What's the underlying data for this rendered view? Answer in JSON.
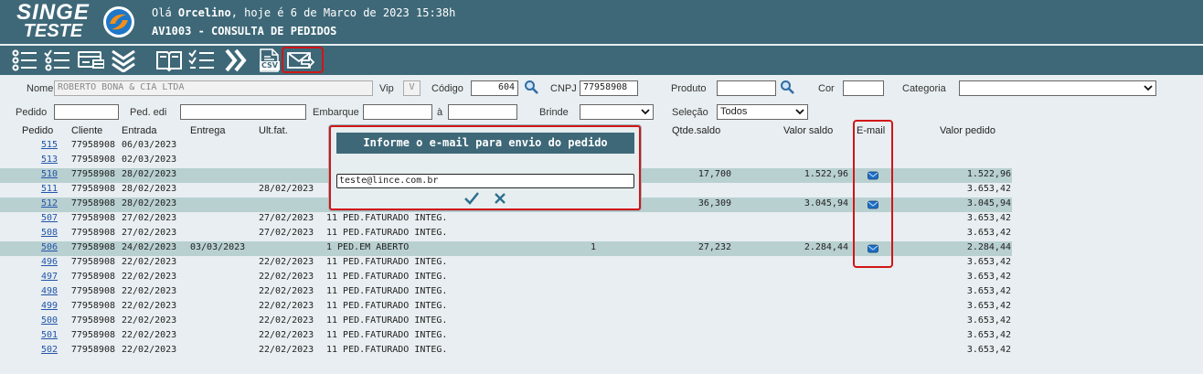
{
  "header": {
    "logo_line1": "SINGE",
    "logo_line2": "TESTE",
    "greeting_prefix": "Olá ",
    "user": "Orcelino",
    "greeting_suffix": ", hoje é 6 de Marco de 2023 15:38h",
    "screen_title": "AV1003 - CONSULTA DE PEDIDOS"
  },
  "toolbar": {
    "icons": [
      "list-icon",
      "checklist-icon",
      "card-icon",
      "chevrons-down-icon",
      "book-icon",
      "checklist-alt-icon",
      "chevrons-right-icon",
      "csv-icon",
      "send-email-icon"
    ],
    "csv_label": "CSV"
  },
  "filters": {
    "nome_label": "Nome",
    "nome_value": "ROBERTO BONA & CIA LTDA",
    "vip_label": "Vip",
    "vip_value": "V",
    "codigo_label": "Código",
    "codigo_value": "604",
    "cnpj_label": "CNPJ",
    "cnpj_value": "77958908",
    "produto_label": "Produto",
    "produto_value": "",
    "cor_label": "Cor",
    "cor_value": "",
    "categoria_label": "Categoria",
    "categoria_value": "",
    "pedido_label": "Pedido",
    "pedido_value": "",
    "ped_edi_label": "Ped. edi",
    "ped_edi_value": "",
    "embarque_label": "Embarque",
    "embarque_from": "",
    "ate_label": "à",
    "embarque_to": "",
    "brinde_label": "Brinde",
    "brinde_value": "",
    "selecao_label": "Seleção",
    "selecao_value": "Todos"
  },
  "table": {
    "headers": {
      "pedido": "Pedido",
      "cliente": "Cliente",
      "entrada": "Entrada",
      "entrega": "Entrega",
      "ult_fat": "Ult.fat.",
      "qtde_saldo": "Qtde.saldo",
      "valor_saldo": "Valor saldo",
      "email": "E-mail",
      "valor_pedido": "Valor pedido"
    },
    "rows": [
      {
        "pedido": "515",
        "cliente": "77958908",
        "entrada": "06/03/2023",
        "entrega": "",
        "ult_fat": "",
        "status": "",
        "qtd": "",
        "qtde_saldo": "",
        "valor_saldo": "",
        "email": false,
        "valor_pedido": "",
        "highlight": false
      },
      {
        "pedido": "513",
        "cliente": "77958908",
        "entrada": "02/03/2023",
        "entrega": "",
        "ult_fat": "",
        "status": "",
        "qtd": "",
        "qtde_saldo": "",
        "valor_saldo": "",
        "email": false,
        "valor_pedido": "",
        "highlight": false
      },
      {
        "pedido": "510",
        "cliente": "77958908",
        "entrada": "28/02/2023",
        "entrega": "",
        "ult_fat": "",
        "status": "",
        "qtd": "",
        "qtde_saldo": "17,700",
        "valor_saldo": "1.522,96",
        "email": true,
        "valor_pedido": "1.522,96",
        "highlight": true
      },
      {
        "pedido": "511",
        "cliente": "77958908",
        "entrada": "28/02/2023",
        "entrega": "",
        "ult_fat": "28/02/2023",
        "status": "",
        "qtd": "",
        "qtde_saldo": "",
        "valor_saldo": "",
        "email": false,
        "valor_pedido": "3.653,42",
        "highlight": false
      },
      {
        "pedido": "512",
        "cliente": "77958908",
        "entrada": "28/02/2023",
        "entrega": "",
        "ult_fat": "",
        "status": "",
        "qtd": "",
        "qtde_saldo": "36,309",
        "valor_saldo": "3.045,94",
        "email": true,
        "valor_pedido": "3.045,94",
        "highlight": true
      },
      {
        "pedido": "507",
        "cliente": "77958908",
        "entrada": "27/02/2023",
        "entrega": "",
        "ult_fat": "27/02/2023",
        "status": "11 PED.FATURADO INTEG.",
        "qtd": "",
        "qtde_saldo": "",
        "valor_saldo": "",
        "email": false,
        "valor_pedido": "3.653,42",
        "highlight": false
      },
      {
        "pedido": "508",
        "cliente": "77958908",
        "entrada": "27/02/2023",
        "entrega": "",
        "ult_fat": "27/02/2023",
        "status": "11 PED.FATURADO INTEG.",
        "qtd": "",
        "qtde_saldo": "",
        "valor_saldo": "",
        "email": false,
        "valor_pedido": "3.653,42",
        "highlight": false
      },
      {
        "pedido": "506",
        "cliente": "77958908",
        "entrada": "24/02/2023",
        "entrega": "03/03/2023",
        "ult_fat": "",
        "status": "1 PED.EM ABERTO",
        "qtd": "1",
        "qtde_saldo": "27,232",
        "valor_saldo": "2.284,44",
        "email": true,
        "valor_pedido": "2.284,44",
        "highlight": true
      },
      {
        "pedido": "496",
        "cliente": "77958908",
        "entrada": "22/02/2023",
        "entrega": "",
        "ult_fat": "22/02/2023",
        "status": "11 PED.FATURADO INTEG.",
        "qtd": "",
        "qtde_saldo": "",
        "valor_saldo": "",
        "email": false,
        "valor_pedido": "3.653,42",
        "highlight": false
      },
      {
        "pedido": "497",
        "cliente": "77958908",
        "entrada": "22/02/2023",
        "entrega": "",
        "ult_fat": "22/02/2023",
        "status": "11 PED.FATURADO INTEG.",
        "qtd": "",
        "qtde_saldo": "",
        "valor_saldo": "",
        "email": false,
        "valor_pedido": "3.653,42",
        "highlight": false
      },
      {
        "pedido": "498",
        "cliente": "77958908",
        "entrada": "22/02/2023",
        "entrega": "",
        "ult_fat": "22/02/2023",
        "status": "11 PED.FATURADO INTEG.",
        "qtd": "",
        "qtde_saldo": "",
        "valor_saldo": "",
        "email": false,
        "valor_pedido": "3.653,42",
        "highlight": false
      },
      {
        "pedido": "499",
        "cliente": "77958908",
        "entrada": "22/02/2023",
        "entrega": "",
        "ult_fat": "22/02/2023",
        "status": "11 PED.FATURADO INTEG.",
        "qtd": "",
        "qtde_saldo": "",
        "valor_saldo": "",
        "email": false,
        "valor_pedido": "3.653,42",
        "highlight": false
      },
      {
        "pedido": "500",
        "cliente": "77958908",
        "entrada": "22/02/2023",
        "entrega": "",
        "ult_fat": "22/02/2023",
        "status": "11 PED.FATURADO INTEG.",
        "qtd": "",
        "qtde_saldo": "",
        "valor_saldo": "",
        "email": false,
        "valor_pedido": "3.653,42",
        "highlight": false
      },
      {
        "pedido": "501",
        "cliente": "77958908",
        "entrada": "22/02/2023",
        "entrega": "",
        "ult_fat": "22/02/2023",
        "status": "11 PED.FATURADO INTEG.",
        "qtd": "",
        "qtde_saldo": "",
        "valor_saldo": "",
        "email": false,
        "valor_pedido": "3.653,42",
        "highlight": false
      },
      {
        "pedido": "502",
        "cliente": "77958908",
        "entrada": "22/02/2023",
        "entrega": "",
        "ult_fat": "22/02/2023",
        "status": "11 PED.FATURADO INTEG.",
        "qtd": "",
        "qtde_saldo": "",
        "valor_saldo": "",
        "email": false,
        "valor_pedido": "3.653,42",
        "highlight": false
      }
    ]
  },
  "modal": {
    "title": "Informe o e-mail para envio do pedido",
    "email_value": "teste@lince.com.br"
  },
  "colors": {
    "header_bg": "#3e6878",
    "page_bg": "#e8eef1",
    "row_highlight": "#b9d0d1",
    "annotation_red": "#d01616",
    "link": "#2255aa"
  }
}
